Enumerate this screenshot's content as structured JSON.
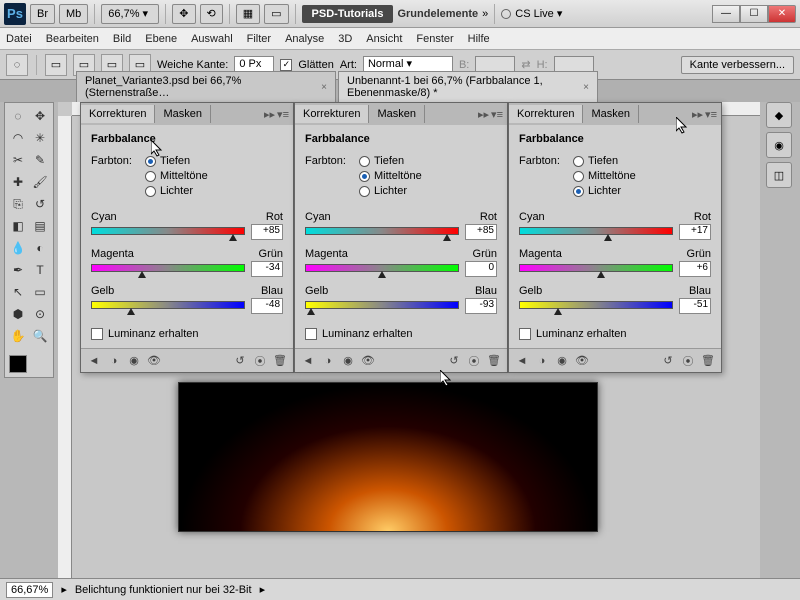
{
  "titlebar": {
    "ps": "Ps",
    "br": "Br",
    "mb": "Mb",
    "zoom": "66,7%",
    "zoomsep": "▾",
    "hand": "✥",
    "reset": "⟲",
    "arrange": "▦",
    "screen": "▭",
    "tab_active": "PSD-Tutorials",
    "tab_plain": "Grundelemente",
    "expand": "»",
    "cslive": "CS Live ▾",
    "min": "—",
    "max": "☐",
    "close": "✕"
  },
  "menu": [
    "Datei",
    "Bearbeiten",
    "Bild",
    "Ebene",
    "Auswahl",
    "Filter",
    "Analyse",
    "3D",
    "Ansicht",
    "Fenster",
    "Hilfe"
  ],
  "optbar": {
    "marq": "◌",
    "feather_label": "Weiche Kante:",
    "feather_val": "0 Px",
    "antialias": "Glätten",
    "antialias_check": "✓",
    "style_label": "Art:",
    "style_val": "Normal",
    "w": "B:",
    "h": "H:",
    "refine": "Kante verbessern..."
  },
  "doctabs": {
    "t1": "Planet_Variante3.psd bei 66,7% (Sternenstraße…",
    "t2": "Unbenannt-1 bei 66,7% (Farbbalance 1, Ebenenmaske/8) *"
  },
  "panels": {
    "tab_korr": "Korrekturen",
    "tab_mask": "Masken",
    "title": "Farbbalance",
    "farbton": "Farbton:",
    "tiefen": "Tiefen",
    "mittel": "Mitteltöne",
    "lichter": "Lichter",
    "cyan": "Cyan",
    "rot": "Rot",
    "magenta": "Magenta",
    "gruen": "Grün",
    "gelb": "Gelb",
    "blau": "Blau",
    "luminanz": "Luminanz erhalten",
    "p1": {
      "sel": 0,
      "v1": "+85",
      "v2": "-34",
      "v3": "-48",
      "t1": 92,
      "t2": 33,
      "t3": 26
    },
    "p2": {
      "sel": 1,
      "v1": "+85",
      "v2": "0",
      "v3": "-93",
      "t1": 92,
      "t2": 50,
      "t3": 4
    },
    "p3": {
      "sel": 2,
      "v1": "+17",
      "v2": "+6",
      "v3": "-51",
      "t1": 58,
      "t2": 53,
      "t3": 25
    }
  },
  "status": {
    "zoom": "66,67%",
    "msg": "Belichtung funktioniert nur bei 32-Bit",
    "arrow": "▸"
  }
}
